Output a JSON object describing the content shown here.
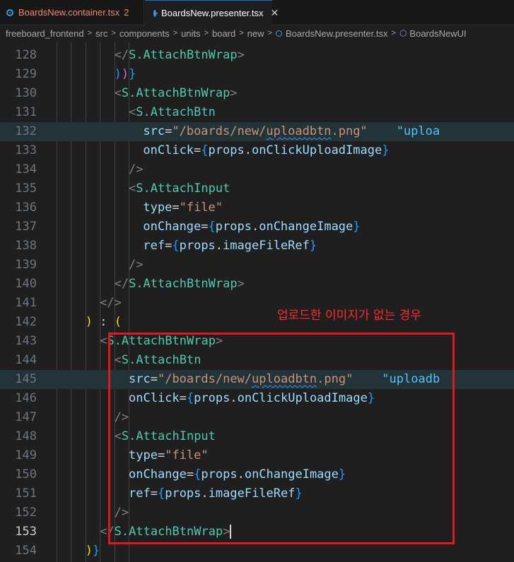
{
  "tabs": [
    {
      "name": "BoardsNew.container.tsx",
      "badge": "2",
      "close": ""
    },
    {
      "name": "BoardsNew.presenter.tsx",
      "close": "✕"
    }
  ],
  "breadcrumb": [
    "freeboard_frontend",
    "src",
    "components",
    "units",
    "board",
    "new",
    "BoardsNew.presenter.tsx",
    "BoardsNewUI"
  ],
  "annotation": "업로드한 이미지가 없는 경우",
  "lines": [
    {
      "num": "128",
      "parts": [
        [
          "t-tag",
          "</"
        ],
        [
          "t-comp",
          "S.AttachBtnWrap"
        ],
        [
          "t-tag",
          ">"
        ]
      ]
    },
    {
      "num": "129",
      "parts": [
        [
          "t-br3",
          ")"
        ],
        [
          "t-brace",
          ")"
        ],
        [
          "t-br3",
          "}"
        ]
      ]
    },
    {
      "num": "130",
      "parts": [
        [
          "t-tag",
          "<"
        ],
        [
          "t-comp",
          "S.AttachBtnWrap"
        ],
        [
          "t-tag",
          ">"
        ]
      ]
    },
    {
      "num": "131",
      "parts": [
        [
          "t-tag",
          "<"
        ],
        [
          "t-comp",
          "S.AttachBtn"
        ]
      ]
    },
    {
      "num": "132",
      "parts": [
        [
          "t-attr",
          "src"
        ],
        [
          "t-plain",
          "="
        ],
        [
          "t-str",
          "\"/boards/new/"
        ],
        [
          "t-str squig",
          "uploadbtn"
        ],
        [
          "t-str",
          ".png\""
        ],
        [
          "t-plain",
          "    "
        ],
        [
          "t-str2",
          "\"uploa"
        ]
      ]
    },
    {
      "num": "133",
      "parts": [
        [
          "t-attr",
          "onClick"
        ],
        [
          "t-plain",
          "="
        ],
        [
          "t-br3",
          "{"
        ],
        [
          "t-attr",
          "props"
        ],
        [
          "t-plain",
          "."
        ],
        [
          "t-attr",
          "onClickUploadImage"
        ],
        [
          "t-br3",
          "}"
        ]
      ]
    },
    {
      "num": "134",
      "parts": [
        [
          "t-tag",
          "/>"
        ]
      ]
    },
    {
      "num": "135",
      "parts": [
        [
          "t-tag",
          "<"
        ],
        [
          "t-comp",
          "S.AttachInput"
        ]
      ]
    },
    {
      "num": "136",
      "parts": [
        [
          "t-attr",
          "type"
        ],
        [
          "t-plain",
          "="
        ],
        [
          "t-str",
          "\"file\""
        ]
      ]
    },
    {
      "num": "137",
      "parts": [
        [
          "t-attr",
          "onChange"
        ],
        [
          "t-plain",
          "="
        ],
        [
          "t-br3",
          "{"
        ],
        [
          "t-attr",
          "props"
        ],
        [
          "t-plain",
          "."
        ],
        [
          "t-attr",
          "onChangeImage"
        ],
        [
          "t-br3",
          "}"
        ]
      ]
    },
    {
      "num": "138",
      "parts": [
        [
          "t-attr",
          "ref"
        ],
        [
          "t-plain",
          "="
        ],
        [
          "t-br3",
          "{"
        ],
        [
          "t-attr",
          "props"
        ],
        [
          "t-plain",
          "."
        ],
        [
          "t-attr",
          "imageFileRef"
        ],
        [
          "t-br3",
          "}"
        ]
      ]
    },
    {
      "num": "139",
      "parts": [
        [
          "t-tag",
          "/>"
        ]
      ]
    },
    {
      "num": "140",
      "parts": [
        [
          "t-tag",
          "</"
        ],
        [
          "t-comp",
          "S.AttachBtnWrap"
        ],
        [
          "t-tag",
          ">"
        ]
      ]
    },
    {
      "num": "141",
      "parts": [
        [
          "t-tag",
          "</>"
        ]
      ]
    },
    {
      "num": "142",
      "parts": [
        [
          "t-br1",
          ")"
        ],
        [
          "t-plain",
          " : "
        ],
        [
          "t-br1",
          "("
        ]
      ]
    },
    {
      "num": "143",
      "parts": [
        [
          "t-tag",
          "<"
        ],
        [
          "t-comp",
          "S.AttachBtnWrap"
        ],
        [
          "t-tag",
          ">"
        ]
      ]
    },
    {
      "num": "144",
      "parts": [
        [
          "t-tag",
          "<"
        ],
        [
          "t-comp",
          "S.AttachBtn"
        ]
      ]
    },
    {
      "num": "145",
      "parts": [
        [
          "t-attr",
          "src"
        ],
        [
          "t-plain",
          "="
        ],
        [
          "t-str",
          "\"/boards/new/"
        ],
        [
          "t-str squig",
          "uploadbtn"
        ],
        [
          "t-str",
          ".png\""
        ],
        [
          "t-plain",
          "    "
        ],
        [
          "t-str2",
          "\"uploadb"
        ]
      ]
    },
    {
      "num": "146",
      "parts": [
        [
          "t-attr",
          "onClick"
        ],
        [
          "t-plain",
          "="
        ],
        [
          "t-br3",
          "{"
        ],
        [
          "t-attr",
          "props"
        ],
        [
          "t-plain",
          "."
        ],
        [
          "t-attr",
          "onClickUploadImage"
        ],
        [
          "t-br3",
          "}"
        ]
      ]
    },
    {
      "num": "147",
      "parts": [
        [
          "t-tag",
          "/>"
        ]
      ]
    },
    {
      "num": "148",
      "parts": [
        [
          "t-tag",
          "<"
        ],
        [
          "t-comp",
          "S.AttachInput"
        ]
      ]
    },
    {
      "num": "149",
      "parts": [
        [
          "t-attr",
          "type"
        ],
        [
          "t-plain",
          "="
        ],
        [
          "t-str",
          "\"file\""
        ]
      ]
    },
    {
      "num": "150",
      "parts": [
        [
          "t-attr",
          "onChange"
        ],
        [
          "t-plain",
          "="
        ],
        [
          "t-br3",
          "{"
        ],
        [
          "t-attr",
          "props"
        ],
        [
          "t-plain",
          "."
        ],
        [
          "t-attr",
          "onChangeImage"
        ],
        [
          "t-br3",
          "}"
        ]
      ]
    },
    {
      "num": "151",
      "parts": [
        [
          "t-attr",
          "ref"
        ],
        [
          "t-plain",
          "="
        ],
        [
          "t-br3",
          "{"
        ],
        [
          "t-attr",
          "props"
        ],
        [
          "t-plain",
          "."
        ],
        [
          "t-attr",
          "imageFileRef"
        ],
        [
          "t-br3",
          "}"
        ]
      ]
    },
    {
      "num": "152",
      "parts": [
        [
          "t-tag",
          "/>"
        ]
      ]
    },
    {
      "num": "153",
      "parts": [
        [
          "t-tag",
          "</"
        ],
        [
          "t-comp",
          "S.AttachBtnWrap"
        ],
        [
          "t-tag",
          ">"
        ]
      ]
    },
    {
      "num": "154",
      "parts": [
        [
          "t-br1",
          ")"
        ],
        [
          "t-br3",
          "}"
        ]
      ]
    }
  ]
}
